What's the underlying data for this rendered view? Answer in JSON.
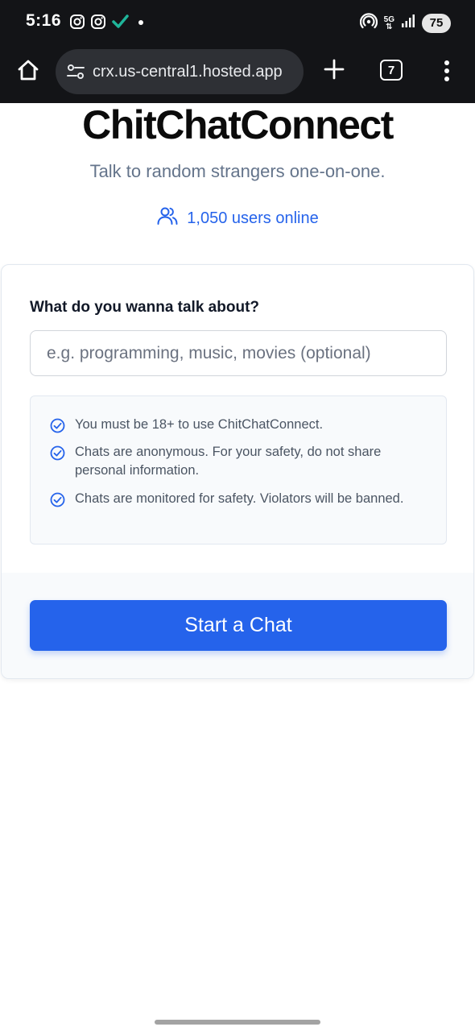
{
  "status_bar": {
    "time": "5:16",
    "network_label": "5G",
    "battery": "75",
    "left_icons": [
      "instagram-icon",
      "instagram-icon",
      "check-icon",
      "notification-dot-icon"
    ],
    "right_icons": [
      "hotspot-icon",
      "5g-icon",
      "signal-icon",
      "battery-icon"
    ]
  },
  "browser": {
    "url": "crx.us-central1.hosted.app",
    "tab_count": "7",
    "icons": [
      "home-icon",
      "site-settings-icon",
      "plus-icon",
      "tabs-icon",
      "more-vert-icon"
    ]
  },
  "page": {
    "title": "ChitChatConnect",
    "subtitle": "Talk to random strangers one-on-one.",
    "online_text": "1,050 users online",
    "online_icon": "users-icon"
  },
  "card": {
    "label": "What do you wanna talk about?",
    "input_value": "",
    "input_placeholder": "e.g. programming, music, movies (optional)",
    "rules": [
      "You must be 18+ to use ChitChatConnect.",
      "Chats are anonymous. For your safety, do not share personal information.",
      "Chats are monitored for safety. Violators will be banned."
    ],
    "rule_icon": "check-circle-icon",
    "start_button": "Start a Chat"
  },
  "colors": {
    "accent": "#2563eb",
    "status_bar_bg": "#131417",
    "url_pill_bg": "#2e3035",
    "muted_text": "#64748b",
    "card_border": "#e2e8f0",
    "panel_bg": "#f8fafc",
    "check_green": "#1fb59a"
  }
}
